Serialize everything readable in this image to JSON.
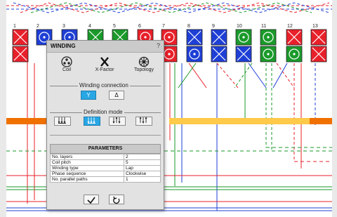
{
  "dialog": {
    "title": "WINDING",
    "help": "?",
    "tools": [
      {
        "label": "Coil",
        "icon": "coil-icon"
      },
      {
        "label": "X-Factor",
        "icon": "x-factor-icon"
      },
      {
        "label": "Topology",
        "icon": "topology-icon"
      }
    ],
    "connection": {
      "title": "Winding connection",
      "options": [
        {
          "glyph": "Y",
          "name": "star",
          "selected": true
        },
        {
          "glyph": "Δ",
          "name": "delta",
          "selected": false
        }
      ]
    },
    "definition": {
      "title": "Definition mode",
      "options": [
        {
          "icon": "mode-1-icon",
          "selected": false
        },
        {
          "icon": "mode-2-icon",
          "selected": true
        },
        {
          "icon": "mode-3-icon",
          "selected": false
        },
        {
          "icon": "mode-4-icon",
          "selected": false
        }
      ]
    },
    "parameters": {
      "title": "PARAMETERS",
      "rows": [
        {
          "key": "No. layers",
          "value": "2"
        },
        {
          "key": "Coil pitch",
          "value": "5"
        },
        {
          "key": "Winding type",
          "value": "Lap"
        },
        {
          "key": "Phase sequence",
          "value": "Clockwise"
        },
        {
          "key": "No. parallel paths",
          "value": "1"
        }
      ]
    },
    "actions": [
      {
        "icon": "check-icon"
      },
      {
        "icon": "undo-icon"
      }
    ]
  },
  "diagram": {
    "slot_numbers": [
      "1",
      "2",
      "3",
      "4",
      "5",
      "6",
      "7",
      "8",
      "9",
      "10",
      "11",
      "12",
      "13"
    ],
    "colors": {
      "red": "#e8202a",
      "blue": "#1e3fd6",
      "green": "#1a9a2a",
      "orange": "#f07000",
      "yellow": "#ffc94a"
    }
  }
}
